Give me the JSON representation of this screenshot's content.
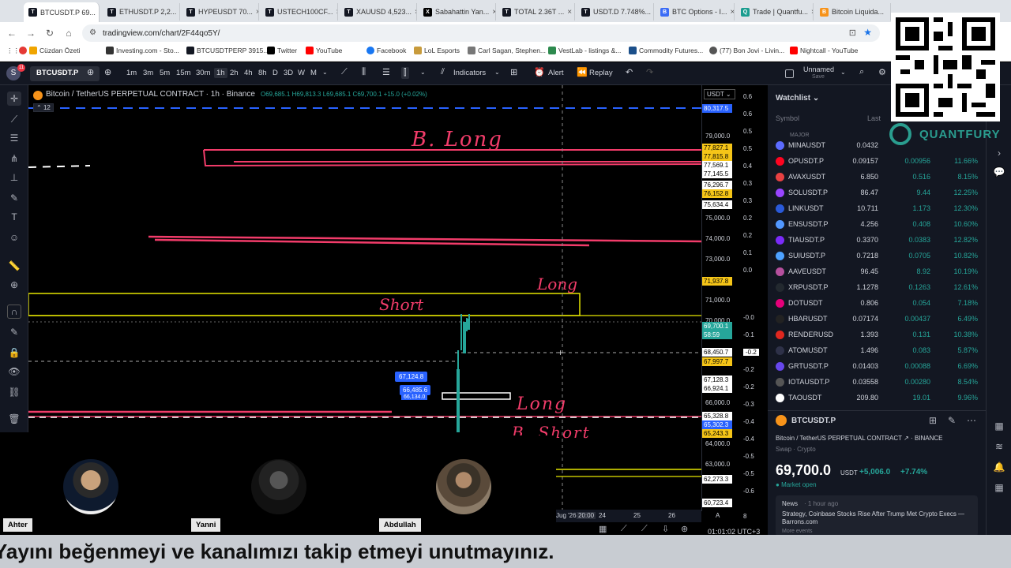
{
  "browser": {
    "tabs": [
      {
        "label": "BTCUSDT.P 69..."
      },
      {
        "label": "ETHUSDT.P 2,2..."
      },
      {
        "label": "HYPEUSDT 70..."
      },
      {
        "label": "USTECH100CF..."
      },
      {
        "label": "XAUUSD 4,523..."
      },
      {
        "label": "Sabahattin Yan..."
      },
      {
        "label": "TOTAL 2.36T ..."
      },
      {
        "label": "USDT.D 7.748%..."
      },
      {
        "label": "BTC Options - I..."
      },
      {
        "label": "Trade | Quantfu..."
      },
      {
        "label": "Bitcoin Liquida..."
      }
    ],
    "url": "tradingview.com/chart/2F44qo5Y/",
    "bookmarks": [
      {
        "label": "Cüzdan Özeti"
      },
      {
        "label": "Investing.com - Sto..."
      },
      {
        "label": "BTCUSDTPERP 3915..."
      },
      {
        "label": "Twitter"
      },
      {
        "label": "YouTube"
      },
      {
        "label": "Facebook"
      },
      {
        "label": "LoL Esports"
      },
      {
        "label": "Carl Sagan, Stephen..."
      },
      {
        "label": "VestLab - listings &..."
      },
      {
        "label": "Commodity Futures..."
      },
      {
        "label": "(77) Bon Jovi - Livin..."
      },
      {
        "label": "Nightcall - YouTube"
      }
    ]
  },
  "toolbar": {
    "symbol": "BTCUSDT.P",
    "intervals": [
      "1m",
      "3m",
      "5m",
      "15m",
      "30m",
      "1h",
      "2h",
      "4h",
      "8h",
      "D",
      "3D",
      "W",
      "M"
    ],
    "active_interval": "1h",
    "indicators": "Indicators",
    "alert": "Alert",
    "replay": "Replay",
    "layout_name": "Unnamed",
    "layout_sub": "Save"
  },
  "chart": {
    "legend_title": "Bitcoin / TetherUS PERPETUAL CONTRACT · 1h · Binance",
    "ohlc": "O69,685.1 H69,813.3 L69,685.1 C69,700.1 +15.0 (+0.02%)",
    "indicator_count": "12",
    "annotations": {
      "b_long": "B. Long",
      "long_top": "Long",
      "short": "Short",
      "long_bottom": "Long",
      "b_short": "B. Short"
    },
    "measure_labels": [
      "67,124.8",
      "66,485.6",
      "66,134.0"
    ],
    "date_labels": [
      "Jug '26",
      "20:00",
      "24",
      "25",
      "26",
      "A"
    ],
    "clock": "01:01:02 UTC+3"
  },
  "price_axis": {
    "currency": "USDT",
    "ticks": [
      "79,000.0",
      "75,000.0",
      "74,000.0",
      "73,000.0",
      "71,000.0",
      "70,000.0",
      "66,000.0",
      "64,000.0",
      "63,000.0"
    ],
    "boxes": [
      {
        "label": "80,317.5",
        "color": "#2962ff"
      },
      {
        "label": "77,827.1",
        "color": "#f5c518"
      },
      {
        "label": "77,815.8",
        "color": "#f5c518"
      },
      {
        "label": "77,569.1",
        "color": "#ffffff"
      },
      {
        "label": "77,145.5",
        "color": "#ffffff"
      },
      {
        "label": "76,296.7",
        "color": "#ffffff"
      },
      {
        "label": "76,152.8",
        "color": "#f5c518"
      },
      {
        "label": "75,634.4",
        "color": "#ffffff"
      },
      {
        "label": "71,937.8",
        "color": "#f5c518"
      },
      {
        "label": "69,700.1",
        "color": "#26a69a"
      },
      {
        "label": "58:59",
        "color": "#26a69a"
      },
      {
        "label": "68,450.7",
        "color": "#ffffff"
      },
      {
        "label": "67,997.7",
        "color": "#f5c518"
      },
      {
        "label": "67,128.3",
        "color": "#ffffff"
      },
      {
        "label": "66,924.1",
        "color": "#ffffff"
      },
      {
        "label": "65,328.8",
        "color": "#ffffff"
      },
      {
        "label": "65,302.3",
        "color": "#2962ff"
      },
      {
        "label": "65,243.3",
        "color": "#f5c518"
      },
      {
        "label": "62,273.3",
        "color": "#ffffff"
      },
      {
        "label": "60,723.4",
        "color": "#ffffff"
      }
    ],
    "right_ticks": [
      "0.6",
      "0.6",
      "0.5",
      "0.5",
      "0.4",
      "0.3",
      "0.3",
      "0.2",
      "0.2",
      "0.1",
      "0.0",
      "-0.0",
      "-0.1",
      "-0.2",
      "-0.2",
      "-0.2",
      "-0.3",
      "-0.4",
      "-0.4",
      "-0.5",
      "-0.5",
      "-0.6"
    ]
  },
  "watchlist": {
    "title": "Watchlist",
    "col_symbol": "Symbol",
    "col_last": "Last",
    "section": "MAJOR",
    "rows": [
      {
        "sym": "MINAUSDT",
        "last": "0.0432",
        "chg": "",
        "pct": "",
        "color": "#5b6bff"
      },
      {
        "sym": "OPUSDT.P",
        "last": "0.09157",
        "chg": "0.00956",
        "pct": "11.66%",
        "color": "#ff0420"
      },
      {
        "sym": "AVAXUSDT",
        "last": "6.850",
        "chg": "0.516",
        "pct": "8.15%",
        "color": "#e84142"
      },
      {
        "sym": "SOLUSDT.P",
        "last": "86.47",
        "chg": "9.44",
        "pct": "12.25%",
        "color": "#9945ff"
      },
      {
        "sym": "LINKUSDT",
        "last": "10.711",
        "chg": "1.173",
        "pct": "12.30%",
        "color": "#2a5ada"
      },
      {
        "sym": "ENSUSDT.P",
        "last": "4.256",
        "chg": "0.408",
        "pct": "10.60%",
        "color": "#5298ff"
      },
      {
        "sym": "TIAUSDT.P",
        "last": "0.3370",
        "chg": "0.0383",
        "pct": "12.82%",
        "color": "#7b2bf9"
      },
      {
        "sym": "SUIUSDT.P",
        "last": "0.7218",
        "chg": "0.0705",
        "pct": "10.82%",
        "color": "#4da2ff"
      },
      {
        "sym": "AAVEUSDT",
        "last": "96.45",
        "chg": "8.92",
        "pct": "10.19%",
        "color": "#b6509e"
      },
      {
        "sym": "XRPUSDT.P",
        "last": "1.1278",
        "chg": "0.1263",
        "pct": "12.61%",
        "color": "#23292f"
      },
      {
        "sym": "DOTUSDT",
        "last": "0.806",
        "chg": "0.054",
        "pct": "7.18%",
        "color": "#e6007a"
      },
      {
        "sym": "HBARUSDT",
        "last": "0.07174",
        "chg": "0.00437",
        "pct": "6.49%",
        "color": "#222222"
      },
      {
        "sym": "RENDERUSD",
        "last": "1.393",
        "chg": "0.131",
        "pct": "10.38%",
        "color": "#e0271f"
      },
      {
        "sym": "ATOMUSDT",
        "last": "1.496",
        "chg": "0.083",
        "pct": "5.87%",
        "color": "#2e3148"
      },
      {
        "sym": "GRTUSDT.P",
        "last": "0.01403",
        "chg": "0.00088",
        "pct": "6.69%",
        "color": "#6747ed"
      },
      {
        "sym": "IOTAUSDT.P",
        "last": "0.03558",
        "chg": "0.00280",
        "pct": "8.54%",
        "color": "#555555"
      },
      {
        "sym": "TAOUSDT",
        "last": "209.80",
        "chg": "19.01",
        "pct": "9.96%",
        "color": "#ffffff"
      }
    ]
  },
  "detail": {
    "symbol": "BTCUSDT.P",
    "name": "Bitcoin / TetherUS PERPETUAL CONTRACT",
    "exchange": "BINANCE",
    "type": "Swap · Crypto",
    "price": "69,700.0",
    "currency": "USDT",
    "change": "+5,006.0",
    "change_pct": "+7.74%",
    "market_status": "Market open",
    "news_tag": "News",
    "news_time": "1 hour ago",
    "news_headline": "Strategy, Coinbase Stocks Rise After Trump Met Crypto Execs — Barrons.com",
    "news_more": "More events"
  },
  "stream": {
    "participants": [
      "Ahter",
      "Yanni",
      "Abdullah"
    ],
    "banner": "Yayını beğenmeyi ve kanalımızı takip etmeyi unutmayınız.",
    "sponsor": "QUANTFURY"
  }
}
